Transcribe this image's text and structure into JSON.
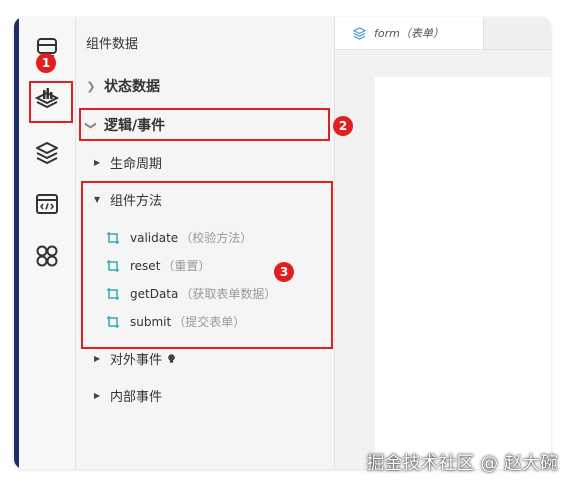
{
  "panel": {
    "title": "组件数据",
    "sections": {
      "state_data": "状态数据",
      "logic_events": "逻辑/事件",
      "lifecycle": "生命周期",
      "component_methods": "组件方法",
      "external_events": "对外事件",
      "internal_events": "内部事件"
    },
    "methods": [
      {
        "name": "validate",
        "desc": "（校验方法）"
      },
      {
        "name": "reset",
        "desc": "（重置）"
      },
      {
        "name": "getData",
        "desc": "（获取表单数据）"
      },
      {
        "name": "submit",
        "desc": "（提交表单）"
      }
    ]
  },
  "editor": {
    "tab_label": "form（表单）"
  },
  "annotations": [
    "1",
    "2",
    "3"
  ],
  "watermark": "掘金技术社区 @ 赵大碗",
  "colors": {
    "highlight": "#e02020",
    "window_edge": "#1e2f63",
    "method_icon": "#3bb0b8"
  },
  "icons": [
    "cards-icon",
    "logic-stack-icon",
    "layers-icon",
    "code-window-icon",
    "component-grid-icon"
  ]
}
